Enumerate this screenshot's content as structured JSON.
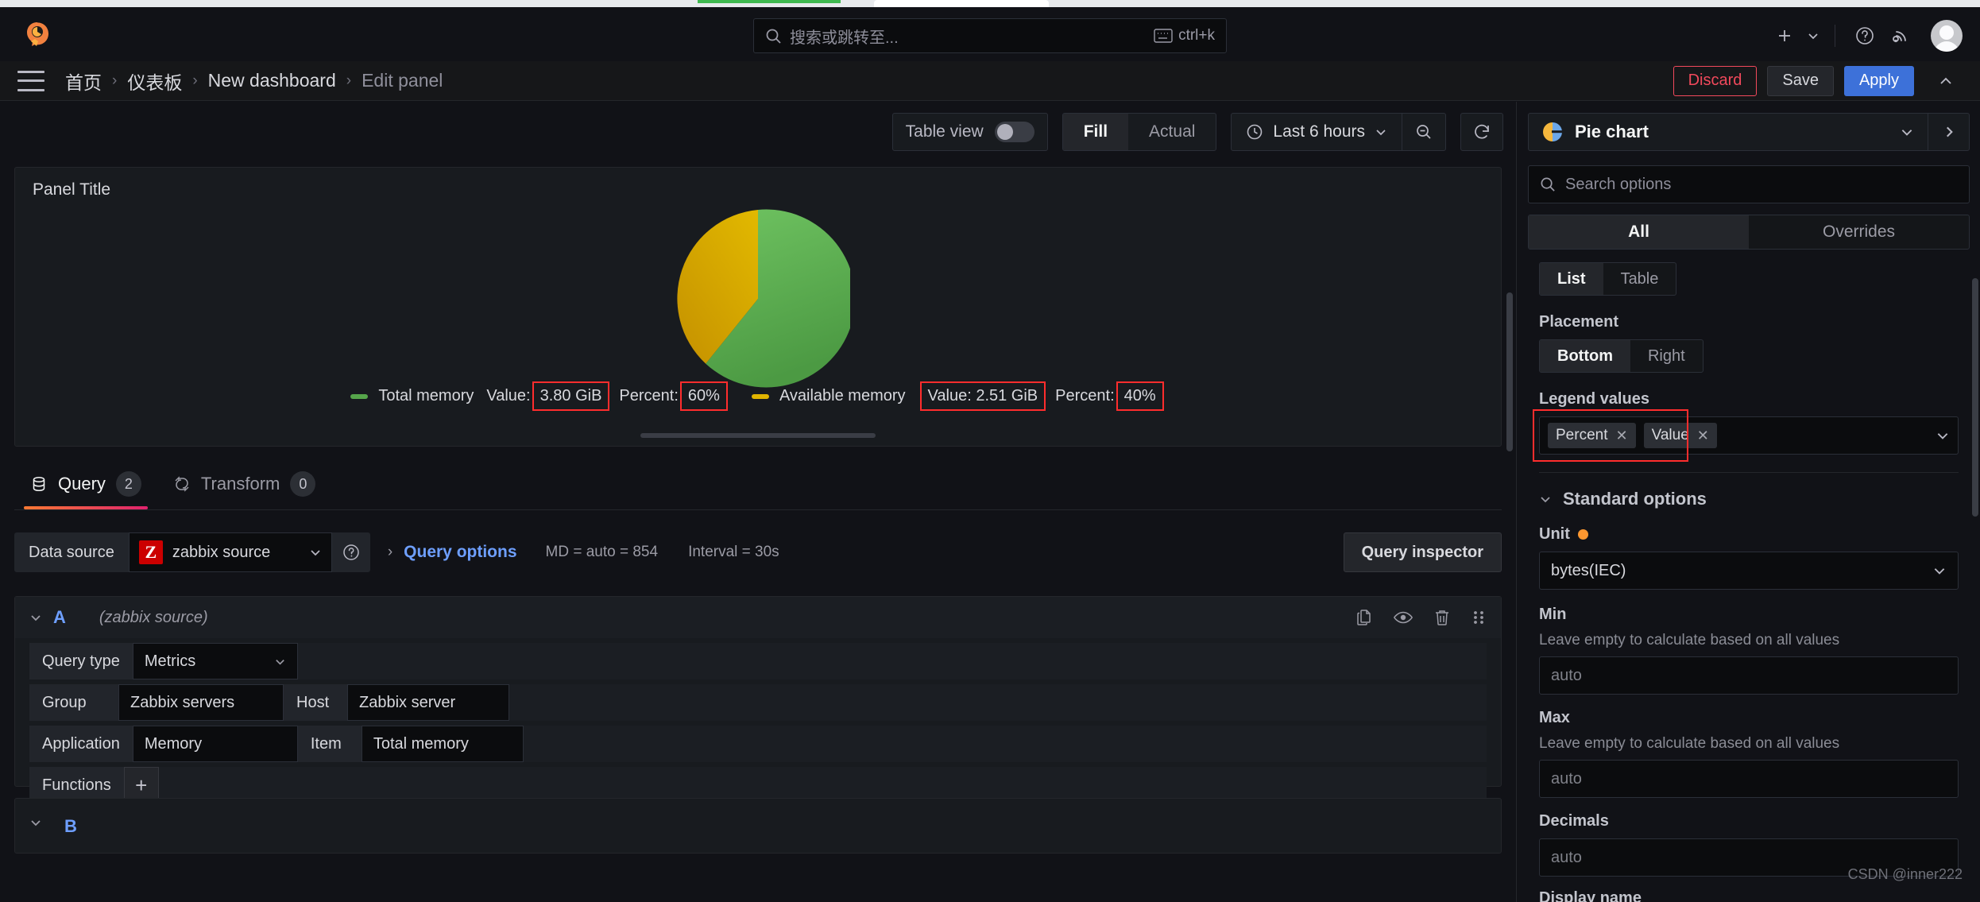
{
  "browser": {
    "tab_accent": "#3fb950"
  },
  "topnav": {
    "logo": "grafana-logo",
    "search": {
      "placeholder": "搜索或跳转至...",
      "shortcut": "ctrl+k"
    },
    "actions": [
      {
        "name": "add-menu",
        "icon": "plus-icon"
      },
      {
        "name": "help",
        "icon": "question-circle-icon"
      },
      {
        "name": "news",
        "icon": "rss-icon"
      },
      {
        "name": "profile",
        "icon": "avatar"
      }
    ]
  },
  "breadcrumb": {
    "items": [
      {
        "label": "首页",
        "current": false
      },
      {
        "label": "仪表板",
        "current": false
      },
      {
        "label": "New dashboard",
        "current": false
      },
      {
        "label": "Edit panel",
        "current": true
      }
    ],
    "separator": "›"
  },
  "header_actions": {
    "discard": "Discard",
    "save": "Save",
    "apply": "Apply"
  },
  "viz_toolbar": {
    "table_view_label": "Table view",
    "table_view_on": false,
    "fill_actual": {
      "options": [
        "Fill",
        "Actual"
      ],
      "selected": "Fill"
    },
    "time_range": "Last 6 hours",
    "zoom_out_icon": "zoom-out-icon",
    "refresh_icon": "refresh-icon"
  },
  "panel": {
    "title": "Panel Title",
    "legend": [
      {
        "name": "Total memory",
        "color": "#56a64b",
        "value_label": "Value:",
        "value": "3.80 GiB",
        "percent_label": "Percent:",
        "percent": "60%"
      },
      {
        "name": "Available memory",
        "color": "#e0b400",
        "value_label": "Value:",
        "value": "2.51 GiB",
        "percent_label": "Percent:",
        "percent": "40%"
      }
    ]
  },
  "chart_data": {
    "type": "pie",
    "title": "Panel Title",
    "labels": [
      "Total memory",
      "Available memory"
    ],
    "values": [
      3.8,
      2.51
    ],
    "percents": [
      60,
      40
    ],
    "value_labels": [
      "3.80 GiB",
      "2.51 GiB"
    ],
    "colors": [
      "#56a64b",
      "#e0b400"
    ],
    "unit": "bytes(IEC)",
    "legend_position": "bottom",
    "legend_values": [
      "Percent",
      "Value"
    ],
    "start_angle_deg": 0,
    "direction": "clockwise"
  },
  "query_tabs": [
    {
      "label": "Query",
      "badge": "2",
      "active": true,
      "icon": "database-icon"
    },
    {
      "label": "Transform",
      "badge": "0",
      "active": false,
      "icon": "transform-icon"
    }
  ],
  "datasource_row": {
    "label": "Data source",
    "value": "zabbix source",
    "logo_letter": "Z",
    "help_icon": "question-circle-icon",
    "query_options_label": "Query options",
    "md": "MD = auto = 854",
    "interval": "Interval = 30s",
    "query_inspector": "Query inspector"
  },
  "query_a": {
    "ref_id": "A",
    "datasource_note": "(zabbix source)",
    "actions": [
      {
        "name": "duplicate-query",
        "icon": "copy-icon"
      },
      {
        "name": "toggle-query-visibility",
        "icon": "eye-icon"
      },
      {
        "name": "remove-query",
        "icon": "trash-icon"
      },
      {
        "name": "drag-query",
        "icon": "drag-handle-icon"
      }
    ],
    "fields": [
      {
        "label": "Query type",
        "value": "Metrics",
        "type": "select"
      },
      {
        "label": "Group",
        "value": "Zabbix servers",
        "type": "select"
      },
      {
        "label": "Host",
        "value": "Zabbix server",
        "type": "select"
      },
      {
        "label": "Application",
        "value": "Memory",
        "type": "select"
      },
      {
        "label": "Item",
        "value": "Total memory",
        "type": "select"
      },
      {
        "label": "Functions",
        "value": "+",
        "type": "button"
      }
    ]
  },
  "query_b": {
    "ref_id": "B"
  },
  "options_pane": {
    "viz_name": "Pie chart",
    "search_placeholder": "Search options",
    "all_overrides": {
      "options": [
        "All",
        "Overrides"
      ],
      "selected": "All"
    },
    "legend_mode": {
      "options": [
        "List",
        "Table"
      ],
      "selected": "List"
    },
    "placement_label": "Placement",
    "placement": {
      "options": [
        "Bottom",
        "Right"
      ],
      "selected": "Bottom"
    },
    "legend_values_label": "Legend values",
    "legend_values_chips": [
      "Percent",
      "Value"
    ],
    "standard_options_label": "Standard options",
    "unit_label": "Unit",
    "unit_value": "bytes(IEC)",
    "min_label": "Min",
    "min_desc": "Leave empty to calculate based on all values",
    "min_placeholder": "auto",
    "max_label": "Max",
    "max_desc": "Leave empty to calculate based on all values",
    "max_placeholder": "auto",
    "decimals_label": "Decimals",
    "decimals_placeholder": "auto",
    "display_name_label": "Display name"
  },
  "watermark": "CSDN @inner222"
}
